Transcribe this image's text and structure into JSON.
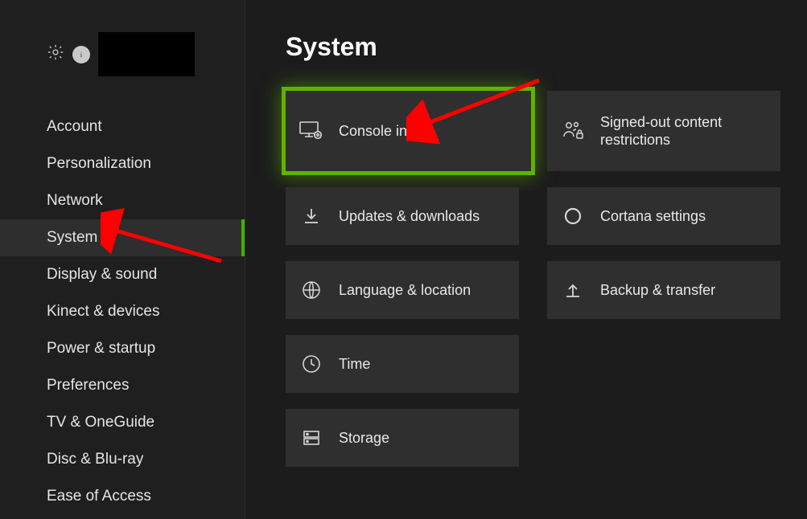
{
  "page": {
    "title": "System"
  },
  "sidebar": {
    "items": [
      {
        "label": "Account"
      },
      {
        "label": "Personalization"
      },
      {
        "label": "Network"
      },
      {
        "label": "System"
      },
      {
        "label": "Display & sound"
      },
      {
        "label": "Kinect & devices"
      },
      {
        "label": "Power & startup"
      },
      {
        "label": "Preferences"
      },
      {
        "label": "TV & OneGuide"
      },
      {
        "label": "Disc & Blu-ray"
      },
      {
        "label": "Ease of Access"
      }
    ],
    "active_index": 3
  },
  "tiles": {
    "left": [
      {
        "id": "console-info",
        "label": "Console info",
        "icon": "console-gear-icon",
        "selected": true
      },
      {
        "id": "updates-downloads",
        "label": "Updates & downloads",
        "icon": "download-icon"
      },
      {
        "id": "language-location",
        "label": "Language & location",
        "icon": "globe-icon"
      },
      {
        "id": "time",
        "label": "Time",
        "icon": "clock-icon"
      },
      {
        "id": "storage",
        "label": "Storage",
        "icon": "storage-icon"
      }
    ],
    "right": [
      {
        "id": "signed-out-restrictions",
        "label": "Signed-out content restrictions",
        "icon": "people-lock-icon"
      },
      {
        "id": "cortana-settings",
        "label": "Cortana settings",
        "icon": "ring-icon"
      },
      {
        "id": "backup-transfer",
        "label": "Backup & transfer",
        "icon": "upload-icon"
      }
    ]
  },
  "annotations": {
    "highlight_color": "#5fb300",
    "arrow_color": "#ff0000"
  }
}
